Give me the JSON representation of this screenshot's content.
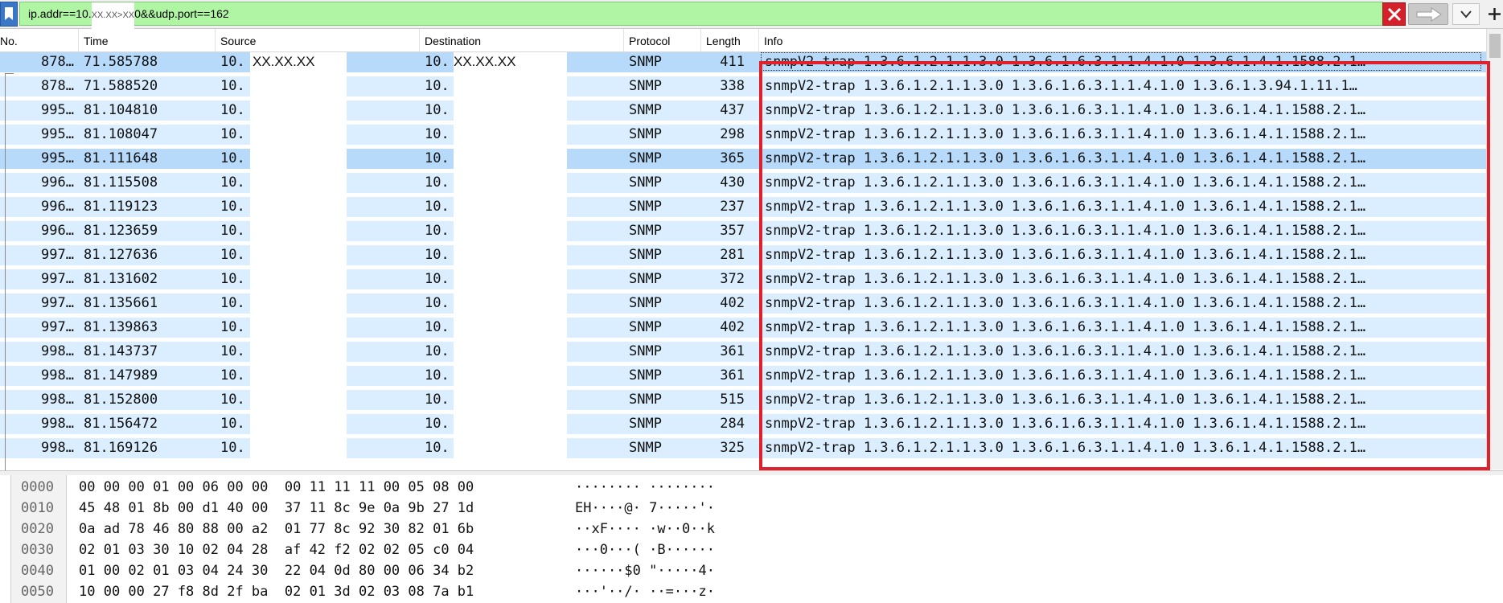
{
  "filter": {
    "prefix": "ip.addr==10.",
    "redacted": "XX.XX>XX",
    "suffix": "0&&udp.port==162"
  },
  "columns": [
    "No.",
    "Time",
    "Source",
    "Destination",
    "Protocol",
    "Length",
    "Info"
  ],
  "redacted_ip": "XX.XX.XX",
  "packets": [
    {
      "no": "878…",
      "time": "71.585788",
      "src": "10.",
      "dst": "10.",
      "proto": "SNMP",
      "len": "411",
      "info": "snmpV2-trap 1.3.6.1.2.1.1.3.0 1.3.6.1.6.3.1.1.4.1.0 1.3.6.1.4.1.1588.2.1…"
    },
    {
      "no": "878…",
      "time": "71.588520",
      "src": "10.",
      "dst": "10.",
      "proto": "SNMP",
      "len": "338",
      "info": "snmpV2-trap 1.3.6.1.2.1.1.3.0 1.3.6.1.6.3.1.1.4.1.0 1.3.6.1.3.94.1.11.1…"
    },
    {
      "no": "995…",
      "time": "81.104810",
      "src": "10.",
      "dst": "10.",
      "proto": "SNMP",
      "len": "437",
      "info": "snmpV2-trap 1.3.6.1.2.1.1.3.0 1.3.6.1.6.3.1.1.4.1.0 1.3.6.1.4.1.1588.2.1…"
    },
    {
      "no": "995…",
      "time": "81.108047",
      "src": "10.",
      "dst": "10.",
      "proto": "SNMP",
      "len": "298",
      "info": "snmpV2-trap 1.3.6.1.2.1.1.3.0 1.3.6.1.6.3.1.1.4.1.0 1.3.6.1.4.1.1588.2.1…"
    },
    {
      "no": "995…",
      "time": "81.111648",
      "src": "10.",
      "dst": "10.",
      "proto": "SNMP",
      "len": "365",
      "info": "snmpV2-trap 1.3.6.1.2.1.1.3.0 1.3.6.1.6.3.1.1.4.1.0 1.3.6.1.4.1.1588.2.1…"
    },
    {
      "no": "996…",
      "time": "81.115508",
      "src": "10.",
      "dst": "10.",
      "proto": "SNMP",
      "len": "430",
      "info": "snmpV2-trap 1.3.6.1.2.1.1.3.0 1.3.6.1.6.3.1.1.4.1.0 1.3.6.1.4.1.1588.2.1…"
    },
    {
      "no": "996…",
      "time": "81.119123",
      "src": "10.",
      "dst": "10.",
      "proto": "SNMP",
      "len": "237",
      "info": "snmpV2-trap 1.3.6.1.2.1.1.3.0 1.3.6.1.6.3.1.1.4.1.0 1.3.6.1.4.1.1588.2.1…"
    },
    {
      "no": "996…",
      "time": "81.123659",
      "src": "10.",
      "dst": "10.",
      "proto": "SNMP",
      "len": "357",
      "info": "snmpV2-trap 1.3.6.1.2.1.1.3.0 1.3.6.1.6.3.1.1.4.1.0 1.3.6.1.4.1.1588.2.1…"
    },
    {
      "no": "997…",
      "time": "81.127636",
      "src": "10.",
      "dst": "10.",
      "proto": "SNMP",
      "len": "281",
      "info": "snmpV2-trap 1.3.6.1.2.1.1.3.0 1.3.6.1.6.3.1.1.4.1.0 1.3.6.1.4.1.1588.2.1…"
    },
    {
      "no": "997…",
      "time": "81.131602",
      "src": "10.",
      "dst": "10.",
      "proto": "SNMP",
      "len": "372",
      "info": "snmpV2-trap 1.3.6.1.2.1.1.3.0 1.3.6.1.6.3.1.1.4.1.0 1.3.6.1.4.1.1588.2.1…"
    },
    {
      "no": "997…",
      "time": "81.135661",
      "src": "10.",
      "dst": "10.",
      "proto": "SNMP",
      "len": "402",
      "info": "snmpV2-trap 1.3.6.1.2.1.1.3.0 1.3.6.1.6.3.1.1.4.1.0 1.3.6.1.4.1.1588.2.1…"
    },
    {
      "no": "997…",
      "time": "81.139863",
      "src": "10.",
      "dst": "10.",
      "proto": "SNMP",
      "len": "402",
      "info": "snmpV2-trap 1.3.6.1.2.1.1.3.0 1.3.6.1.6.3.1.1.4.1.0 1.3.6.1.4.1.1588.2.1…"
    },
    {
      "no": "998…",
      "time": "81.143737",
      "src": "10.",
      "dst": "10.",
      "proto": "SNMP",
      "len": "361",
      "info": "snmpV2-trap 1.3.6.1.2.1.1.3.0 1.3.6.1.6.3.1.1.4.1.0 1.3.6.1.4.1.1588.2.1…"
    },
    {
      "no": "998…",
      "time": "81.147989",
      "src": "10.",
      "dst": "10.",
      "proto": "SNMP",
      "len": "361",
      "info": "snmpV2-trap 1.3.6.1.2.1.1.3.0 1.3.6.1.6.3.1.1.4.1.0 1.3.6.1.4.1.1588.2.1…"
    },
    {
      "no": "998…",
      "time": "81.152800",
      "src": "10.",
      "dst": "10.",
      "proto": "SNMP",
      "len": "515",
      "info": "snmpV2-trap 1.3.6.1.2.1.1.3.0 1.3.6.1.6.3.1.1.4.1.0 1.3.6.1.4.1.1588.2.1…"
    },
    {
      "no": "998…",
      "time": "81.156472",
      "src": "10.",
      "dst": "10.",
      "proto": "SNMP",
      "len": "284",
      "info": "snmpV2-trap 1.3.6.1.2.1.1.3.0 1.3.6.1.6.3.1.1.4.1.0 1.3.6.1.4.1.1588.2.1…"
    },
    {
      "no": "998…",
      "time": "81.169126",
      "src": "10.",
      "dst": "10.",
      "proto": "SNMP",
      "len": "325",
      "info": "snmpV2-trap 1.3.6.1.2.1.1.3.0 1.3.6.1.6.3.1.1.4.1.0 1.3.6.1.4.1.1588.2.1…"
    }
  ],
  "bytes": [
    {
      "offset": "0000",
      "hex": "00 00 00 01 00 06 00 00  00 11 11 11 00 05 08 00",
      "ascii": "········ ········"
    },
    {
      "offset": "0010",
      "hex": "45 48 01 8b 00 d1 40 00  37 11 8c 9e 0a 9b 27 1d",
      "ascii": "EH····@· 7·····'·"
    },
    {
      "offset": "0020",
      "hex": "0a ad 78 46 80 88 00 a2  01 77 8c 92 30 82 01 6b",
      "ascii": "··xF···· ·w··0··k"
    },
    {
      "offset": "0030",
      "hex": "02 01 03 30 10 02 04 28  af 42 f2 02 02 05 c0 04",
      "ascii": "···0···( ·B······"
    },
    {
      "offset": "0040",
      "hex": "01 00 02 01 03 04 24 30  22 04 0d 80 00 06 34 b2",
      "ascii": "······$0 \"·····4·"
    },
    {
      "offset": "0050",
      "hex": "10 00 00 27 f8 8d 2f ba  02 01 3d 02 03 08 7a b1",
      "ascii": "···'··/· ··=···z·"
    }
  ],
  "colors": {
    "filter_valid": "#aff5a4",
    "row_bg": "#daeeff",
    "row_selected": "#b7dafb",
    "highlight": "#e0202a"
  }
}
